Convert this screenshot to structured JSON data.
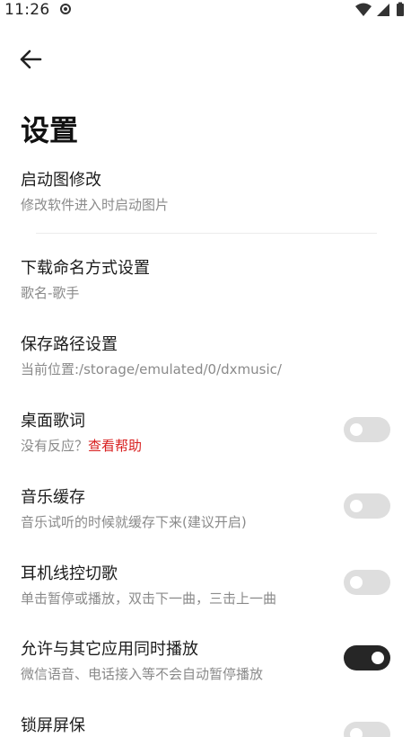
{
  "status": {
    "time": "11:26"
  },
  "page": {
    "title": "设置"
  },
  "settings": [
    {
      "title": "启动图修改",
      "subtitle": "修改软件进入时启动图片",
      "has_toggle": false
    },
    {
      "title": "下载命名方式设置",
      "subtitle": "歌名-歌手",
      "has_toggle": false
    },
    {
      "title": "保存路径设置",
      "subtitle": "当前位置:/storage/emulated/0/dxmusic/",
      "has_toggle": false
    },
    {
      "title": "桌面歌词",
      "subtitle": "没有反应？",
      "link": "查看帮助",
      "has_toggle": true,
      "on": false
    },
    {
      "title": "音乐缓存",
      "subtitle": "音乐试听的时候就缓存下来(建议开启)",
      "has_toggle": true,
      "on": false
    },
    {
      "title": "耳机线控切歌",
      "subtitle": "单击暂停或播放，双击下一曲，三击上一曲",
      "has_toggle": true,
      "on": false
    },
    {
      "title": "允许与其它应用同时播放",
      "subtitle": "微信语音、电话接入等不会自动暂停播放",
      "has_toggle": true,
      "on": true
    },
    {
      "title": "锁屏屏保",
      "subtitle": "",
      "has_toggle": true,
      "on": false
    }
  ],
  "colors": {
    "accent_link": "#d81e1e",
    "toggle_on": "#262626",
    "toggle_off": "#dedede"
  },
  "icons": {
    "back": "arrow-left-icon",
    "wifi": "wifi-icon",
    "signal": "cell-signal-icon",
    "battery": "battery-icon",
    "notif": "notification-dot-icon"
  }
}
